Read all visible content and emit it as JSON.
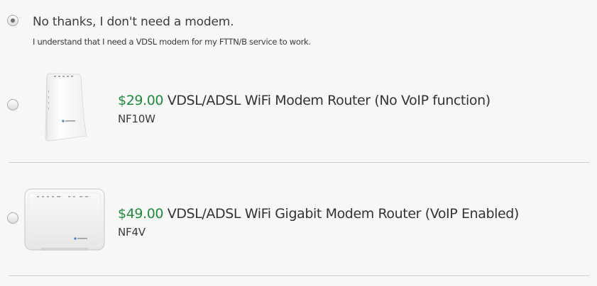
{
  "no_modem": {
    "label": "No thanks, I don't need a modem.",
    "note": "I understand that I need a VDSL modem for my FTTN/B service to work.",
    "selected": true
  },
  "products": [
    {
      "price": "$29.00",
      "name": "VDSL/ADSL WiFi Modem Router (No VoIP function)",
      "model": "NF10W",
      "selected": false
    },
    {
      "price": "$49.00",
      "name": "VDSL/ADSL WiFi Gigabit Modem Router (VoIP Enabled)",
      "model": "NF4V",
      "selected": false
    }
  ],
  "colors": {
    "price": "#1e8a3c",
    "divider": "#cfcfcf"
  }
}
